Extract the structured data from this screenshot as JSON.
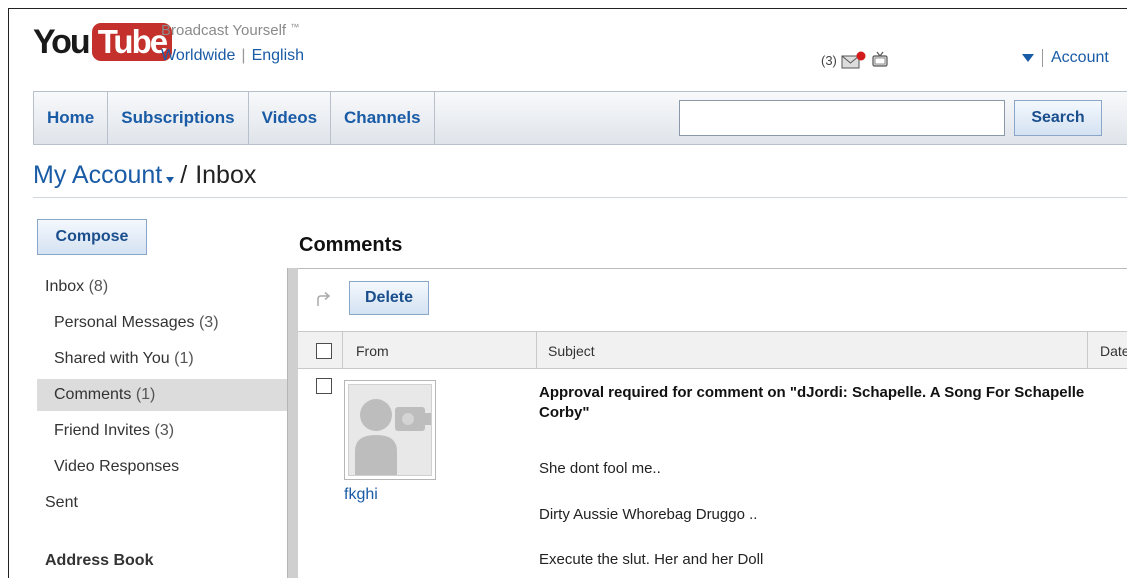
{
  "header": {
    "logo_you": "You",
    "logo_tube": "Tube",
    "tagline": "Broadcast Yourself",
    "trademark": "™",
    "locale_region": "Worldwide",
    "locale_language": "English",
    "notification_count": "(3)",
    "account_label": "Account"
  },
  "nav": {
    "tabs": [
      "Home",
      "Subscriptions",
      "Videos",
      "Channels"
    ],
    "search_value": "",
    "search_button": "Search"
  },
  "breadcrumb": {
    "account": "My Account",
    "separator": "/",
    "current": "Inbox"
  },
  "sidebar": {
    "compose_label": "Compose",
    "items": [
      {
        "label": "Inbox",
        "count": "(8)"
      },
      {
        "label": "Personal Messages",
        "count": "(3)"
      },
      {
        "label": "Shared with You",
        "count": "(1)"
      },
      {
        "label": "Comments",
        "count": "(1)"
      },
      {
        "label": "Friend Invites",
        "count": "(3)"
      },
      {
        "label": "Video Responses",
        "count": ""
      },
      {
        "label": "Sent",
        "count": ""
      },
      {
        "label": "Address Book",
        "count": ""
      }
    ]
  },
  "main": {
    "section_title": "Comments",
    "delete_label": "Delete",
    "columns": {
      "from": "From",
      "subject": "Subject",
      "date": "Date"
    },
    "message": {
      "from": "fkghi",
      "subject": "Approval required for comment on \"dJordi: Schapelle. A Song For Schapelle Corby\"",
      "lines": [
        "She dont fool me..",
        "Dirty Aussie Whorebag Druggo ..",
        "Execute the slut. Her and her Doll"
      ]
    }
  },
  "colors": {
    "link": "#1a5ba6",
    "brand_red": "#c4302b",
    "nav_border": "#b7c0cb"
  }
}
